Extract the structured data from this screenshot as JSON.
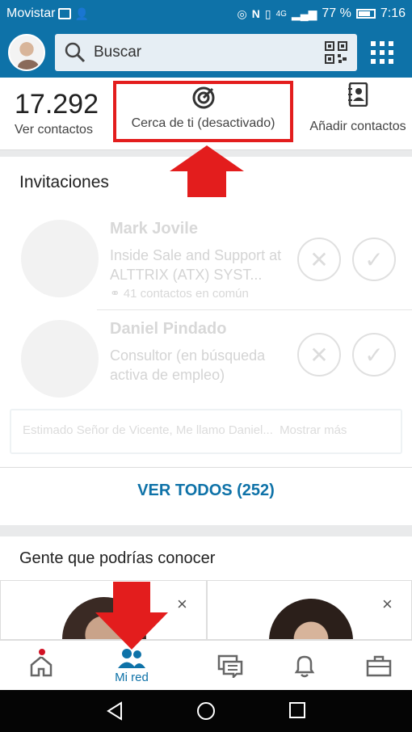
{
  "status_bar": {
    "carrier": "Movistar",
    "signal_label": "4G",
    "battery_percent": "77 %",
    "time": "7:16"
  },
  "header": {
    "search_label": "Buscar",
    "icons": [
      "avatar",
      "search-icon",
      "qr-code-icon",
      "apps-grid-icon"
    ]
  },
  "summary": {
    "connections_count": "17.292",
    "connections_label": "Ver contactos",
    "nearby_label": "Cerca de ti (desactivado)",
    "add_contacts_label": "Añadir contactos"
  },
  "invitations": {
    "title": "Invitaciones",
    "items": [
      {
        "name": "Mark Jovile",
        "headline": "Inside Sale and Support at ALTTRIX (ATX) SYST...",
        "mutual": "41 contactos en común"
      },
      {
        "name": "Daniel Pindado",
        "headline": "Consultor (en búsqueda activa de empleo)",
        "mutual": ""
      }
    ],
    "message_preview": "Estimado Señor de Vicente, Me llamo Daniel...",
    "show_more": "Mostrar más",
    "see_all": "VER TODOS (252)"
  },
  "people_you_may_know": {
    "title": "Gente que podrías conocer",
    "close_symbol": "×"
  },
  "bottom_nav": {
    "items": [
      {
        "label": ""
      },
      {
        "label": "Mi red"
      },
      {
        "label": ""
      },
      {
        "label": ""
      },
      {
        "label": ""
      }
    ]
  },
  "colors": {
    "brand": "#0e72a8",
    "highlight_red": "#e31d1d",
    "notification": "#d11124"
  }
}
